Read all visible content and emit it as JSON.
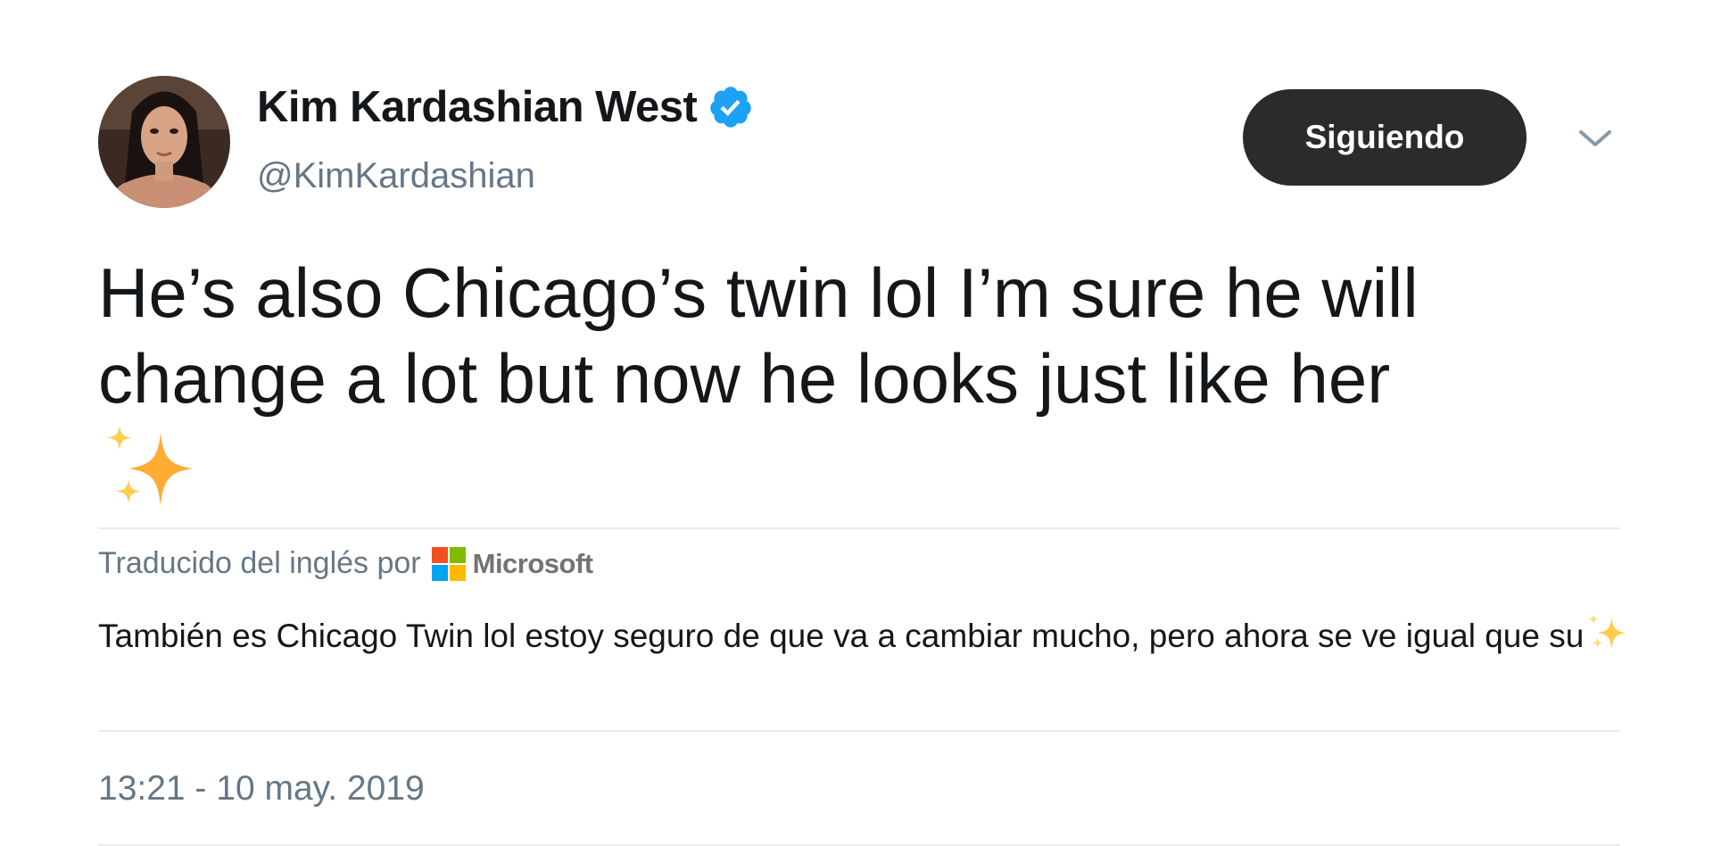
{
  "author": {
    "display_name": "Kim Kardashian West",
    "handle": "@KimKardashian",
    "verified": true,
    "avatar_icon": "profile-photo"
  },
  "follow_button": {
    "label": "Siguiendo"
  },
  "tweet": {
    "text": "He’s also Chicago’s twin lol I’m sure he will change a lot but now he looks just like her",
    "emoji_icon": "sparkles-icon"
  },
  "translation": {
    "attribution": "Traducido del inglés por",
    "provider": "Microsoft",
    "text": "También es Chicago Twin lol estoy seguro de que va a cambiar mucho, pero ahora se ve igual que su"
  },
  "timestamp": "13:21 - 10 may. 2019",
  "colors": {
    "verified": "#1da1f2",
    "button_bg": "#2a2b2d",
    "muted_text": "#657786",
    "divider": "#e6ecf0",
    "sparkle": "#ffac33"
  }
}
